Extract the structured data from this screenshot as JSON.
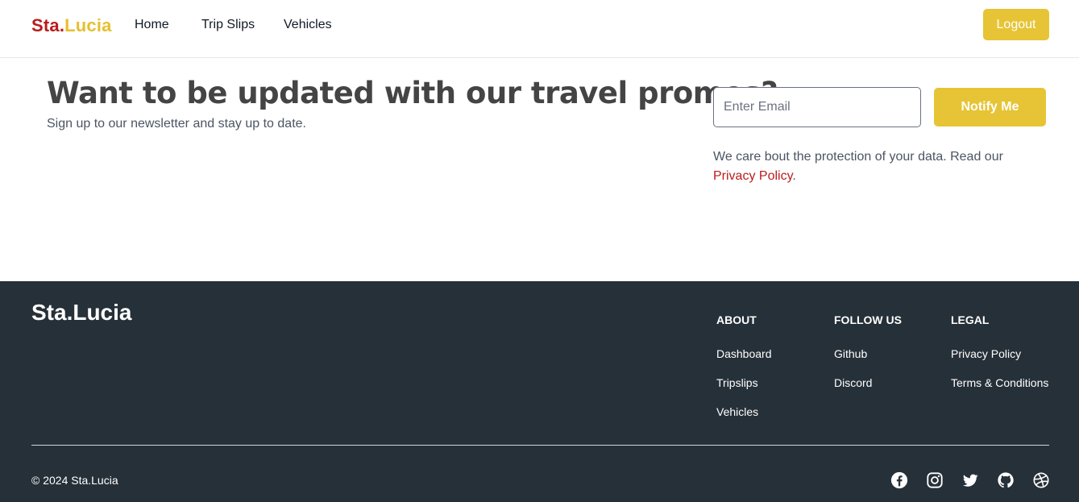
{
  "navbar": {
    "brand_part1": "Sta.",
    "brand_part2": "Lucia",
    "links": [
      "Home",
      "Trip Slips",
      "Vehicles"
    ],
    "logout_label": "Logout"
  },
  "newsletter": {
    "headline": "Want to be updated with our travel promos?",
    "subline": "Sign up to our newsletter and stay up to date.",
    "email_placeholder": "Enter Email",
    "notify_label": "Notify Me",
    "care_text": "We care bout the protection of your data. Read our",
    "privacy_link": "Privacy Policy",
    "care_end": "."
  },
  "footer": {
    "brand": "Sta.Lucia",
    "columns": [
      {
        "heading": "ABOUT",
        "items": [
          "Dashboard",
          "Tripslips",
          "Vehicles"
        ]
      },
      {
        "heading": "FOLLOW US",
        "items": [
          "Github",
          "Discord"
        ]
      },
      {
        "heading": "LEGAL",
        "items": [
          "Privacy Policy",
          "Terms & Conditions"
        ]
      }
    ],
    "copyright": "© 2024 Sta.Lucia",
    "social_icons": [
      "facebook-icon",
      "instagram-icon",
      "twitter-icon",
      "github-icon",
      "dribbble-icon"
    ]
  },
  "colors": {
    "brand_red": "#b91c1c",
    "accent_yellow": "#e6c435",
    "footer_bg": "#263038"
  }
}
